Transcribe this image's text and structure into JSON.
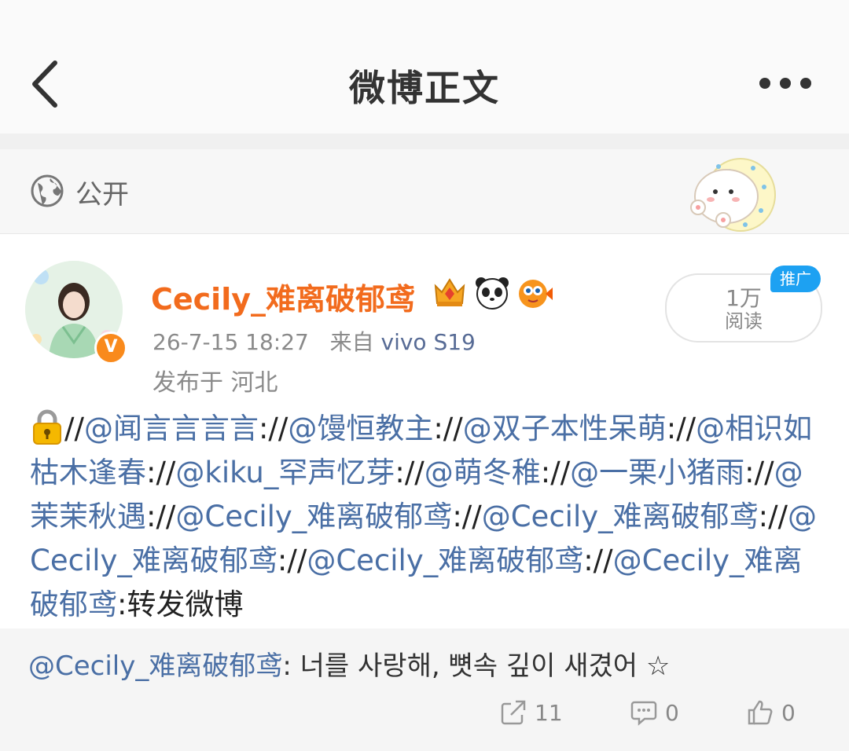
{
  "header": {
    "title": "微博正文"
  },
  "visibility": {
    "label": "公开"
  },
  "author": {
    "name": "Cecily_难离破郁鸢",
    "time": "26-7-15 18:27",
    "source_prefix": "来自",
    "source": "vivo S19",
    "location": "发布于 河北",
    "badges": [
      "crown-badge-icon",
      "panda-icon",
      "pufferfish-icon"
    ]
  },
  "stats": {
    "read_num": "1万",
    "read_label": "阅读",
    "promo": "推广"
  },
  "post": {
    "segments": [
      {
        "type": "text",
        "text": "//"
      },
      {
        "type": "mention",
        "text": "@闻言言言言"
      },
      {
        "type": "text",
        "text": "://"
      },
      {
        "type": "mention",
        "text": "@馒恒教主"
      },
      {
        "type": "text",
        "text": "://"
      },
      {
        "type": "mention",
        "text": "@双子本性呆萌"
      },
      {
        "type": "text",
        "text": "://"
      },
      {
        "type": "mention",
        "text": "@相识如枯木逢春"
      },
      {
        "type": "text",
        "text": "://"
      },
      {
        "type": "mention",
        "text": "@kiku_罕声忆芽"
      },
      {
        "type": "text",
        "text": "://"
      },
      {
        "type": "mention",
        "text": "@萌冬稚"
      },
      {
        "type": "text",
        "text": "://"
      },
      {
        "type": "mention",
        "text": "@一栗小猪雨"
      },
      {
        "type": "text",
        "text": "://"
      },
      {
        "type": "mention",
        "text": "@茉茉秋遇"
      },
      {
        "type": "text",
        "text": "://"
      },
      {
        "type": "mention",
        "text": "@Cecily_难离破郁鸢"
      },
      {
        "type": "text",
        "text": "://"
      },
      {
        "type": "mention",
        "text": "@Cecily_难离破郁鸢"
      },
      {
        "type": "text",
        "text": "://"
      },
      {
        "type": "mention",
        "text": "@Cecily_难离破郁鸢"
      },
      {
        "type": "text",
        "text": "://"
      },
      {
        "type": "mention",
        "text": "@Cecily_难离破郁鸢"
      },
      {
        "type": "text",
        "text": "://"
      },
      {
        "type": "mention",
        "text": "@Cecily_难离破郁鸢"
      },
      {
        "type": "text",
        "text": ":转发微博"
      }
    ]
  },
  "quote": {
    "mention": "@Cecily_难离破郁鸢",
    "text": ":  너를 사랑해, 뼛속 깊이 새겼어 ☆"
  },
  "actions": {
    "repost_count": "11",
    "comment_count": "0",
    "like_count": "0"
  }
}
